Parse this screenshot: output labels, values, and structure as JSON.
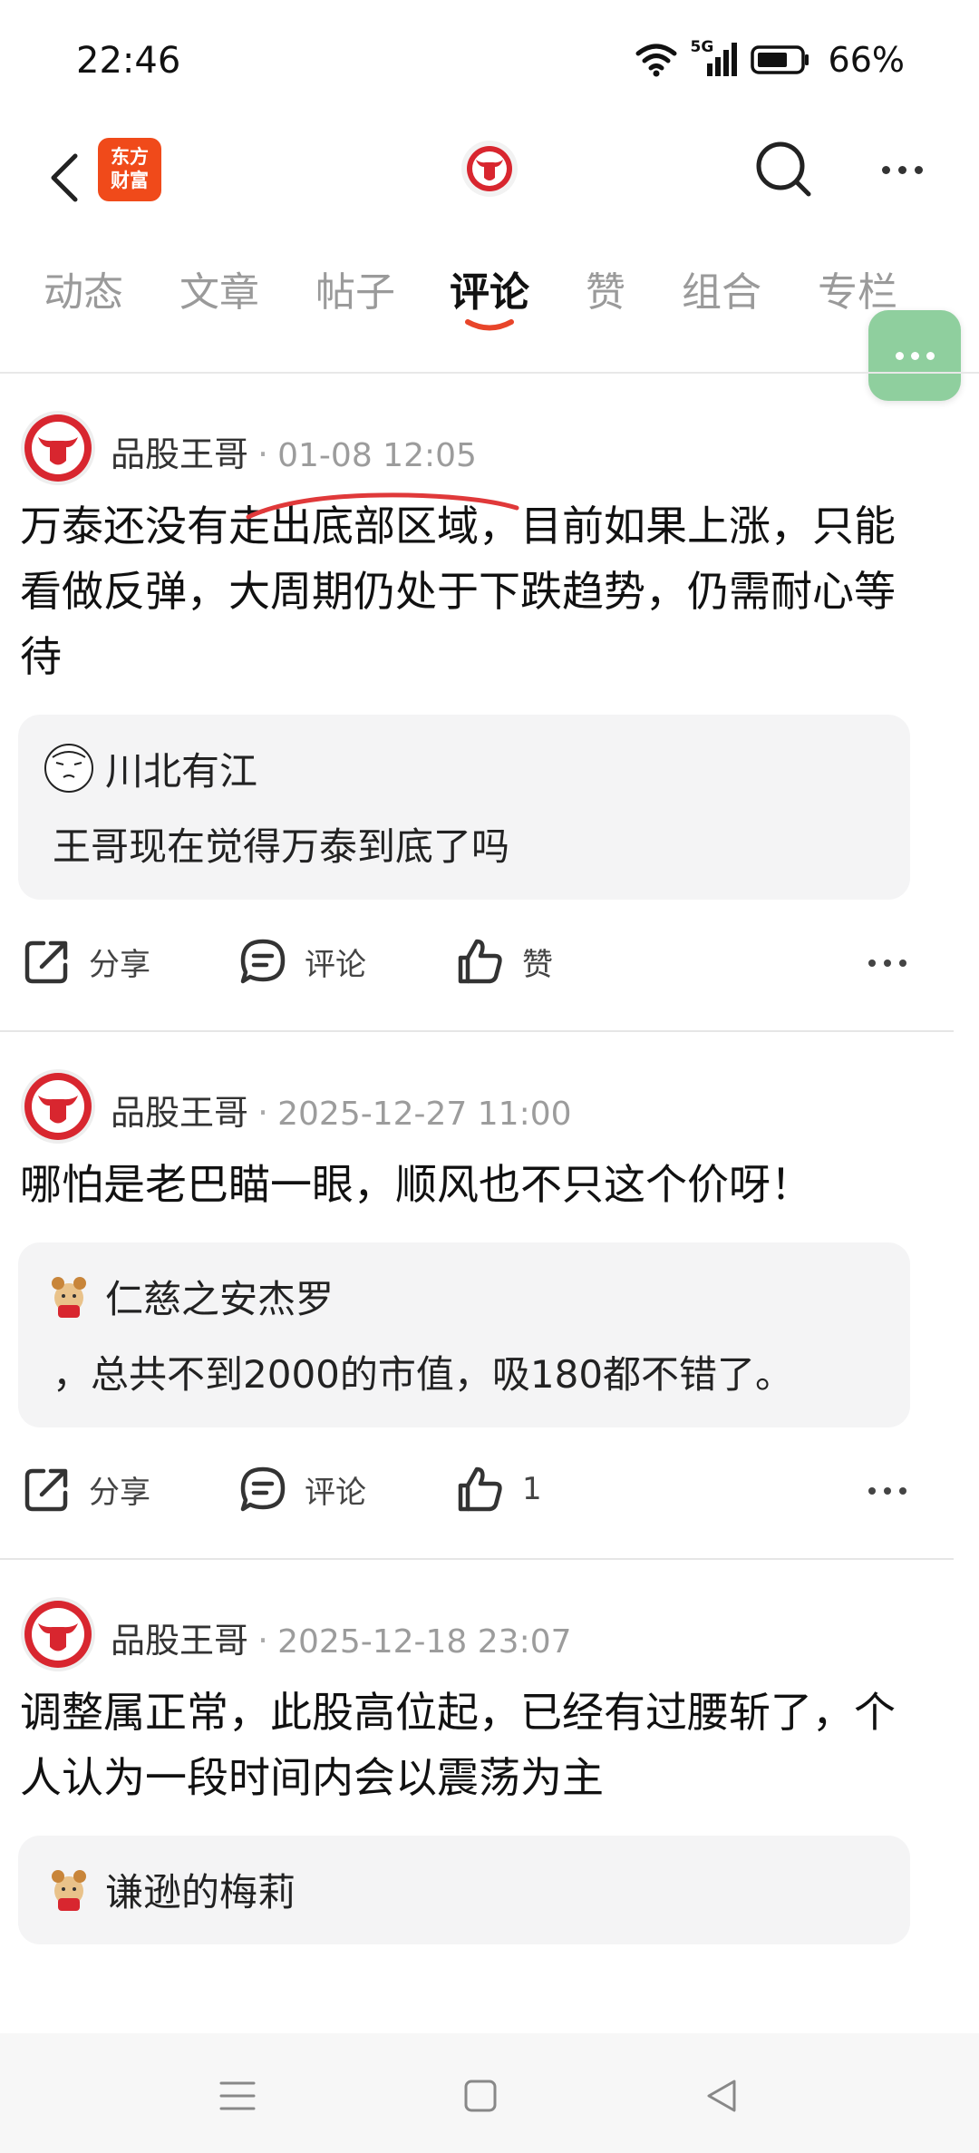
{
  "status_bar": {
    "time": "22:46",
    "network": "5G",
    "battery": "66%"
  },
  "header": {
    "app_logo_text_line1": "东方",
    "app_logo_text_line2": "财富"
  },
  "tabs": [
    {
      "label": "动态",
      "active": false
    },
    {
      "label": "文章",
      "active": false
    },
    {
      "label": "帖子",
      "active": false
    },
    {
      "label": "评论",
      "active": true
    },
    {
      "label": "赞",
      "active": false
    },
    {
      "label": "组合",
      "active": false
    },
    {
      "label": "专栏",
      "active": false
    }
  ],
  "posts": [
    {
      "author": "品股王哥",
      "time": "01-08 12:05",
      "content": "万泰还没有走出底部区域，目前如果上涨，只能看做反弹，大周期仍处于下跌趋势，仍需耐心等待",
      "quote_user": "川北有江",
      "quote_text": "王哥现在觉得万泰到底了吗",
      "share_label": "分享",
      "comment_label": "评论",
      "like_label": "赞"
    },
    {
      "author": "品股王哥",
      "time": "2025-12-27 11:00",
      "content": "哪怕是老巴瞄一眼，顺风也不只这个价呀！",
      "quote_user": "仁慈之安杰罗",
      "quote_text": "，总共不到2000的市值，吸180都不错了。",
      "share_label": "分享",
      "comment_label": "评论",
      "like_label": "1"
    },
    {
      "author": "品股王哥",
      "time": "2025-12-18 23:07",
      "content": "调整属正常，此股高位起，已经有过腰斩了，个人认为一段时间内会以震荡为主",
      "quote_user": "谦逊的梅莉"
    }
  ],
  "colors": {
    "accent": "#e8452a",
    "brand_red": "#d8262f",
    "float_button": "#8fcf9e"
  }
}
